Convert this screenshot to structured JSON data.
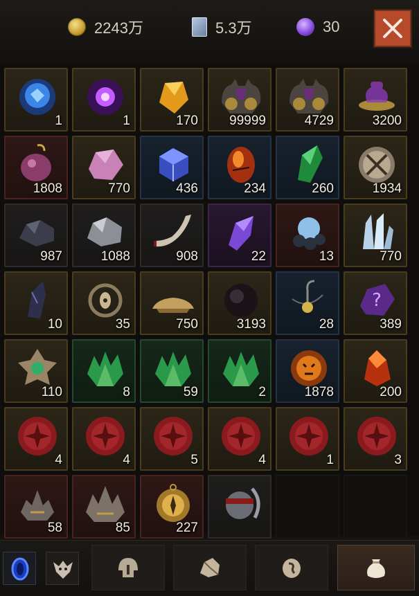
{
  "currencies": [
    {
      "icon": "gold-coin-icon",
      "value": "2243万"
    },
    {
      "icon": "blue-scroll-icon",
      "value": "5.3万"
    },
    {
      "icon": "purple-orb-icon",
      "value": "30"
    }
  ],
  "close_icon": "close-icon",
  "items": [
    {
      "name": "blue-crystal-orb",
      "qty": "1",
      "rarity": "gold"
    },
    {
      "name": "purple-energy-orb",
      "qty": "1",
      "rarity": "gold"
    },
    {
      "name": "amber-crystal",
      "qty": "170",
      "rarity": "gold"
    },
    {
      "name": "spiked-armor-set",
      "qty": "99999",
      "rarity": "gold"
    },
    {
      "name": "spiked-armor-set",
      "qty": "4729",
      "rarity": "gold"
    },
    {
      "name": "purple-smoke-bowl",
      "qty": "3200",
      "rarity": "gold"
    },
    {
      "name": "hooked-pink-orb",
      "qty": "1808",
      "rarity": "red"
    },
    {
      "name": "pink-stone",
      "qty": "770",
      "rarity": "gold"
    },
    {
      "name": "blue-cube-crystal",
      "qty": "436",
      "rarity": "blue"
    },
    {
      "name": "red-fire-egg",
      "qty": "234",
      "rarity": "blue"
    },
    {
      "name": "green-emerald-shard",
      "qty": "260",
      "rarity": "blue"
    },
    {
      "name": "crossed-swords-medallion",
      "qty": "1934",
      "rarity": "gold"
    },
    {
      "name": "dark-ore-chunk",
      "qty": "987",
      "rarity": "gray"
    },
    {
      "name": "silver-ore-chunk",
      "qty": "1088",
      "rarity": "gray"
    },
    {
      "name": "bone-horn",
      "qty": "908",
      "rarity": "gray"
    },
    {
      "name": "violet-crystal",
      "qty": "22",
      "rarity": "purple"
    },
    {
      "name": "blue-pearl-stones",
      "qty": "13",
      "rarity": "red"
    },
    {
      "name": "ice-crystals",
      "qty": "770",
      "rarity": "gold"
    },
    {
      "name": "dark-horn-shard",
      "qty": "10",
      "rarity": "gold"
    },
    {
      "name": "eye-ornament",
      "qty": "35",
      "rarity": "gold"
    },
    {
      "name": "golden-sand-pile",
      "qty": "750",
      "rarity": "gold"
    },
    {
      "name": "dark-sphere",
      "qty": "3193",
      "rarity": "gold"
    },
    {
      "name": "hook-pendant",
      "qty": "28",
      "rarity": "blue"
    },
    {
      "name": "purple-mystery-stone",
      "qty": "389",
      "rarity": "gold"
    },
    {
      "name": "emerald-star-emblem",
      "qty": "110",
      "rarity": "gold"
    },
    {
      "name": "green-crystal-cluster",
      "qty": "8",
      "rarity": "green"
    },
    {
      "name": "green-crystal-cluster",
      "qty": "59",
      "rarity": "green"
    },
    {
      "name": "green-crystal-cluster",
      "qty": "2",
      "rarity": "green"
    },
    {
      "name": "flaming-skull-emblem",
      "qty": "1878",
      "rarity": "blue"
    },
    {
      "name": "fire-ruby-crystal",
      "qty": "200",
      "rarity": "gold"
    },
    {
      "name": "red-wax-seal",
      "qty": "4",
      "rarity": "gold"
    },
    {
      "name": "red-wax-seal",
      "qty": "4",
      "rarity": "gold"
    },
    {
      "name": "red-wax-seal",
      "qty": "5",
      "rarity": "gold"
    },
    {
      "name": "red-wax-seal",
      "qty": "4",
      "rarity": "gold"
    },
    {
      "name": "red-wax-seal",
      "qty": "1",
      "rarity": "gold"
    },
    {
      "name": "red-wax-seal",
      "qty": "3",
      "rarity": "gold"
    },
    {
      "name": "spiked-crown-small",
      "qty": "58",
      "rarity": "red"
    },
    {
      "name": "spiked-crown-large",
      "qty": "85",
      "rarity": "red"
    },
    {
      "name": "golden-compass-disc",
      "qty": "227",
      "rarity": "red"
    },
    {
      "name": "blindfolded-helm",
      "qty": "",
      "rarity": "gray"
    }
  ],
  "bottom": {
    "buttons": [
      "blue-portal-icon",
      "beast-emblem-icon"
    ],
    "tabs": [
      {
        "icon": "helmet-icon",
        "active": false
      },
      {
        "icon": "ore-chunk-icon",
        "active": false
      },
      {
        "icon": "rune-stone-icon",
        "active": false
      },
      {
        "icon": "sack-icon",
        "active": true
      }
    ]
  }
}
